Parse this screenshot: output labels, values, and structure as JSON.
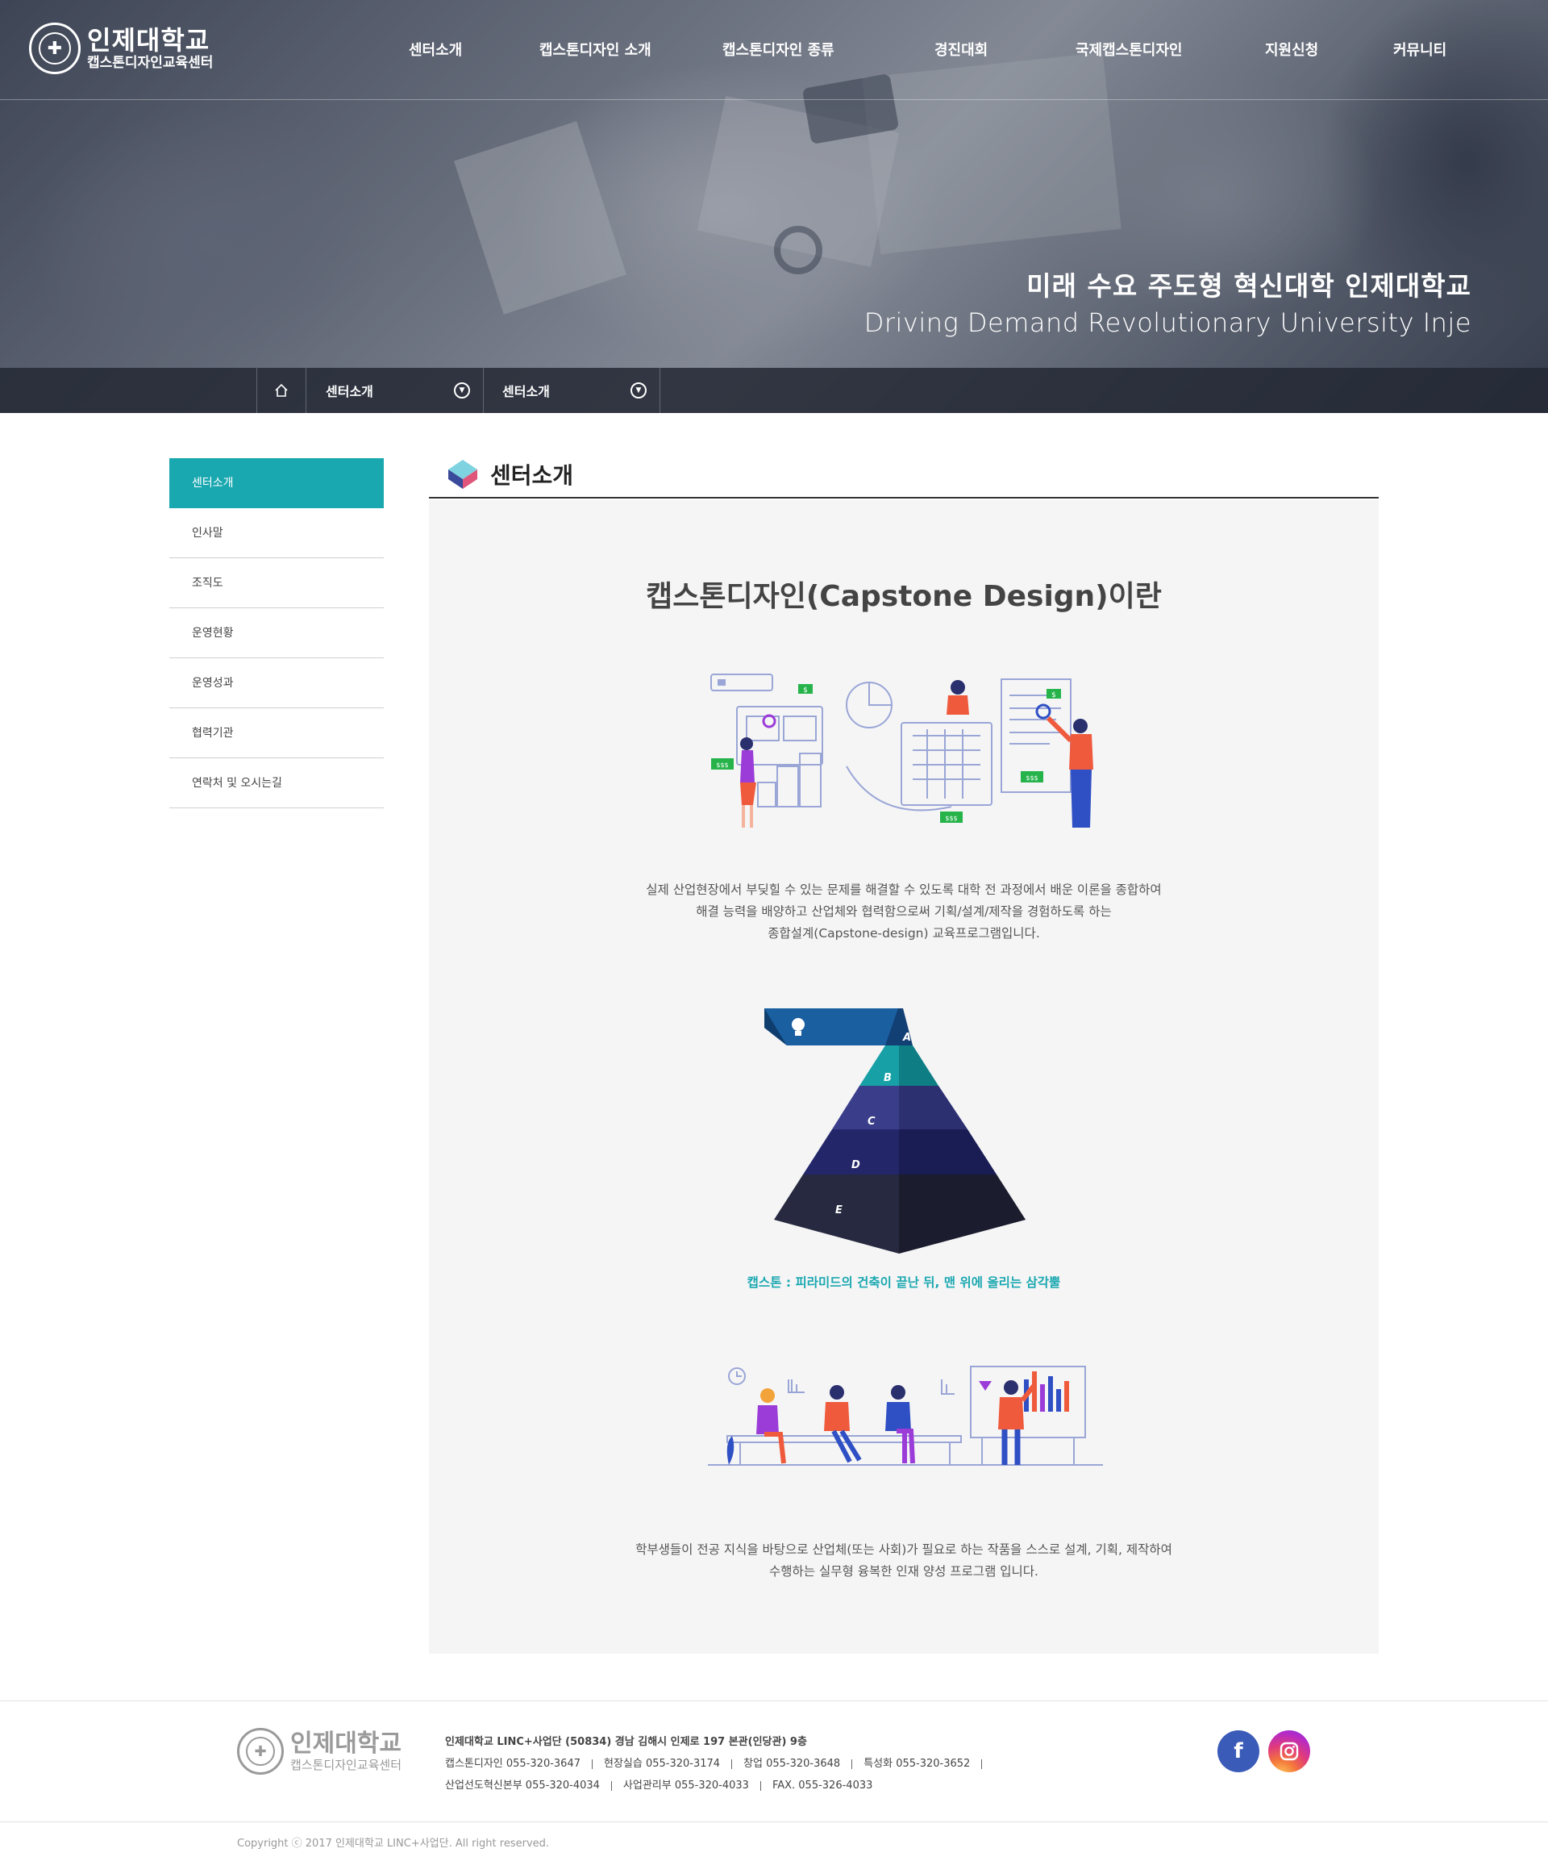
{
  "header": {
    "logo_main": "인제대학교",
    "logo_sub": "캡스톤디자인교육센터",
    "nav": [
      "센터소개",
      "캡스톤디자인 소개",
      "캡스톤디자인 종류",
      "경진대회",
      "국제캡스톤디자인",
      "지원신청",
      "커뮤니티"
    ]
  },
  "hero": {
    "slogan_ko": "미래 수요 주도형 혁신대학 인제대학교",
    "slogan_en": "Driving Demand Revolutionary University Inje"
  },
  "breadcrumb": {
    "level1": "센터소개",
    "level2": "센터소개"
  },
  "sidebar": {
    "items": [
      {
        "label": "센터소개",
        "active": true
      },
      {
        "label": "인사말"
      },
      {
        "label": "조직도"
      },
      {
        "label": "운영현황"
      },
      {
        "label": "운영성과"
      },
      {
        "label": "협력기관"
      },
      {
        "label": "연락처 및 오시는길"
      }
    ]
  },
  "content": {
    "title": "센터소개",
    "heading": "캡스톤디자인(Capstone Design)이란",
    "desc1": [
      "실제 산업현장에서 부딪힐 수 있는 문제를 해결할 수 있도록 대학 전 과정에서 배운 이론을 종합하여",
      "해결 능력을 배양하고 산업체와 협력함으로써 기획/설계/제작을 경험하도록 하는",
      "종합설계(Capstone-design) 교육프로그램입니다."
    ],
    "pyramid_labels": [
      "A",
      "B",
      "C",
      "D",
      "E"
    ],
    "illus1_badges": [
      "$",
      "$$$",
      "$$$",
      "$$$",
      "$"
    ],
    "caption": "캡스톤 : 피라미드의 건축이 끝난 뒤, 맨 위에 올리는 삼각뿔",
    "desc2": [
      "학부생들이 전공 지식을 바탕으로 산업체(또는 사회)가 필요로 하는 작품을 스스로 설계, 기획, 제작하여",
      "수행하는 실무형 융복한 인재 양성 프로그램 입니다."
    ]
  },
  "footer": {
    "logo_main": "인제대학교",
    "logo_sub": "캡스톤디자인교육센터",
    "address": "인제대학교 LINC+사업단 (50834) 경남 김해시 인제로 197 본관(인당관) 9층",
    "contacts_row1": [
      "캡스톤디자인 055-320-3647",
      "현장실습 055-320-3174",
      "창업 055-320-3648",
      "특성화 055-320-3652"
    ],
    "contacts_row2": [
      "산업선도혁신본부 055-320-4034",
      "사업관리부 055-320-4033",
      "FAX. 055-326-4033"
    ],
    "copyright": "Copyright ⓒ 2017 인제대학교 LINC+사업단. All right reserved.",
    "sns": [
      "facebook",
      "instagram"
    ]
  },
  "colors": {
    "accent": "#1aa8b0",
    "pyramid": [
      "#1a5fa0",
      "#17a0a6",
      "#3a3d8a",
      "#23276a",
      "#26293f"
    ],
    "figure_red": "#ef5a3c",
    "figure_blue": "#2f4fc4",
    "money_green": "#25b34a"
  }
}
